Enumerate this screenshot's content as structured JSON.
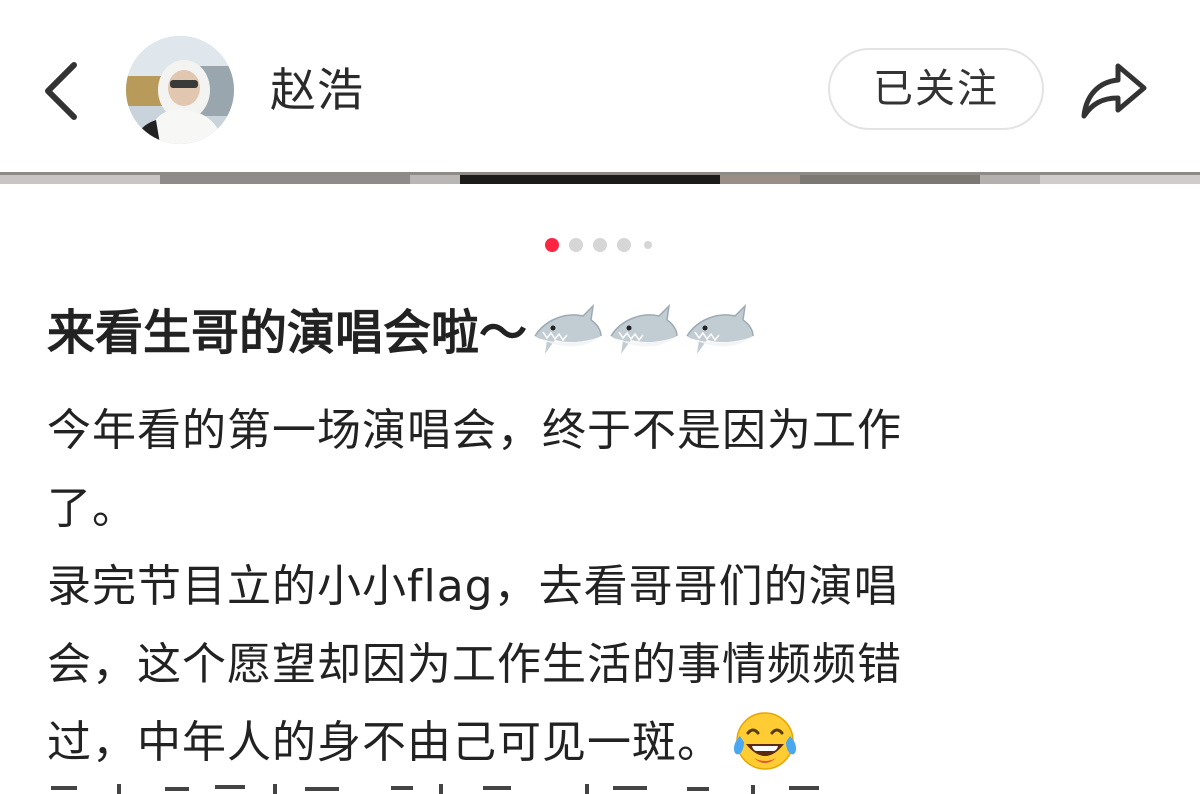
{
  "header": {
    "back_icon": "chevron-left-icon",
    "avatar_icon": "user-avatar",
    "username": "赵浩",
    "follow_label": "已关注",
    "share_icon": "share-arrow-icon"
  },
  "pager": {
    "total_dots": 5,
    "active_index": 0,
    "active_color": "#ff2442",
    "inactive_color": "#d6d6d6"
  },
  "post": {
    "title": "来看生哥的演唱会啦～",
    "title_emoji": [
      "shark",
      "shark",
      "shark"
    ],
    "body_lines": [
      "今年看的第一场演唱会，终于不是因为工作",
      "了。",
      "录完节目立的小小flag，去看哥哥们的演唱",
      "会，这个愿望却因为工作生活的事情频频错",
      "过，中年人的身不由己可见一斑。"
    ],
    "body_trailing_emoji": "tears-of-joy"
  },
  "colors": {
    "accent": "#ff2442",
    "text": "#222222",
    "border": "#e3e3e3"
  }
}
